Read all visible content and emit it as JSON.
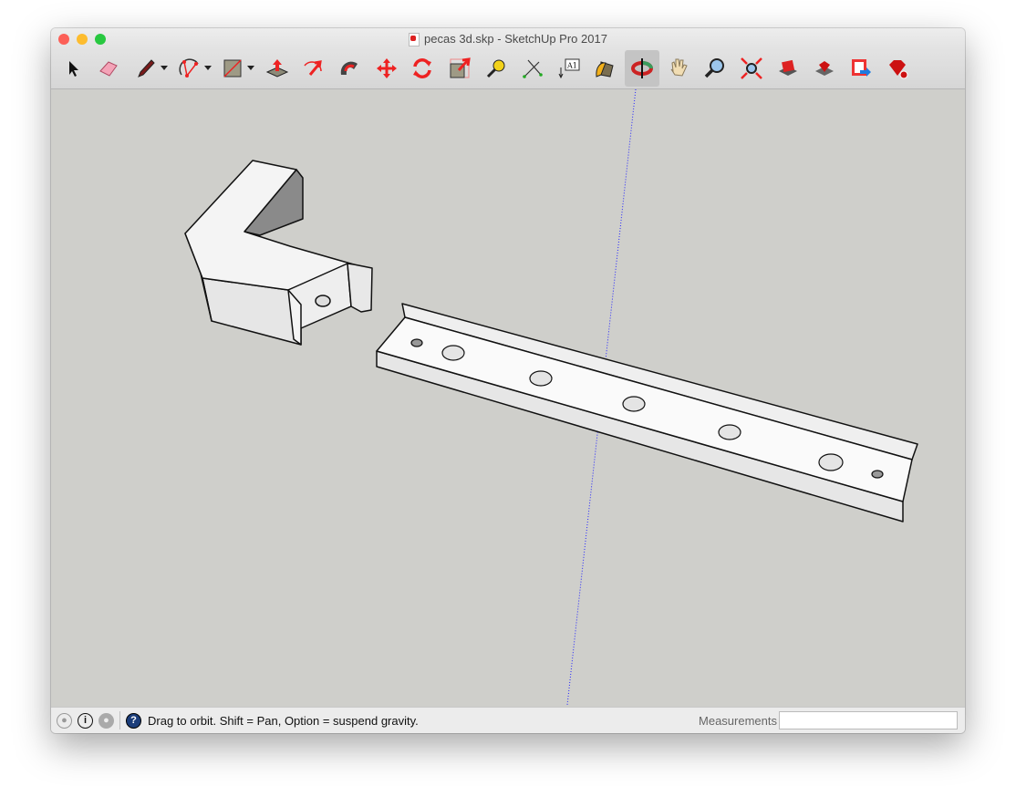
{
  "window": {
    "title": "pecas 3d.skp - SketchUp Pro 2017",
    "traffic_lights": {
      "close": "#fc5f57",
      "minimize": "#fdbc2e",
      "zoom": "#28c840"
    }
  },
  "toolbar": {
    "tools": [
      {
        "name": "select-tool",
        "icon": "arrow-icon"
      },
      {
        "name": "eraser-tool",
        "icon": "eraser-icon"
      },
      {
        "name": "pencil-tool",
        "icon": "pencil-icon",
        "dropdown": true
      },
      {
        "name": "arc-tool",
        "icon": "arc-icon",
        "dropdown": true
      },
      {
        "name": "rectangle-tool",
        "icon": "rectangle-icon",
        "dropdown": true
      },
      {
        "name": "push-pull-tool",
        "icon": "push-pull-icon"
      },
      {
        "name": "offset-tool",
        "icon": "offset-icon"
      },
      {
        "name": "follow-me-tool",
        "icon": "follow-me-icon"
      },
      {
        "name": "move-tool",
        "icon": "move-icon"
      },
      {
        "name": "rotate-tool",
        "icon": "rotate-icon"
      },
      {
        "name": "scale-tool",
        "icon": "scale-icon"
      },
      {
        "name": "tape-measure-tool",
        "icon": "tape-measure-icon"
      },
      {
        "name": "protractor-tool",
        "icon": "protractor-icon"
      },
      {
        "name": "text-tool",
        "icon": "text-icon",
        "label": "A1"
      },
      {
        "name": "paint-bucket-tool",
        "icon": "paint-bucket-icon"
      },
      {
        "name": "orbit-tool",
        "icon": "orbit-icon",
        "active": true
      },
      {
        "name": "pan-tool",
        "icon": "hand-icon"
      },
      {
        "name": "zoom-tool",
        "icon": "magnifier-icon"
      },
      {
        "name": "zoom-extents-tool",
        "icon": "zoom-extents-icon"
      },
      {
        "name": "warehouse-tool",
        "icon": "3d-warehouse-icon"
      },
      {
        "name": "extension-warehouse-tool",
        "icon": "extension-warehouse-icon"
      },
      {
        "name": "send-to-layout-tool",
        "icon": "layout-icon"
      },
      {
        "name": "extension-manager-tool",
        "icon": "ruby-gem-icon"
      }
    ]
  },
  "status": {
    "hint": "Drag to orbit. Shift = Pan, Option = suspend gravity.",
    "measurements_label": "Measurements",
    "measurements_value": "",
    "help_icon_color": "#1b3d7a"
  },
  "viewport": {
    "background": "#cfcfcb",
    "axis_color": "#2222ff"
  }
}
